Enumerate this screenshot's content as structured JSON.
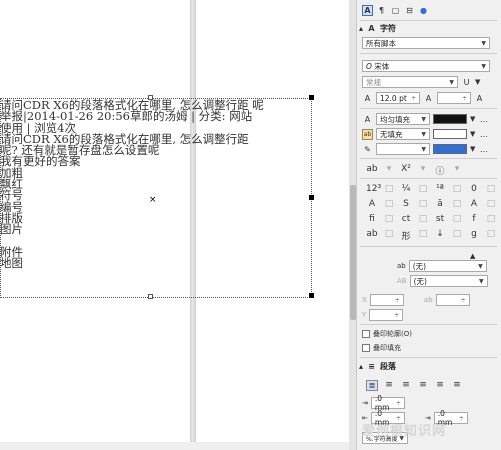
{
  "paragraph_lines": [
    "请问CDR X6的段落格式化在哪里, 怎么调整行距 呢",
    "举报|2014-01-26 20:56草郎的汤姆 | 分类: 网站",
    "使用 | 浏览4次",
    "请问CDR X6的段落格式化在哪里, 怎么调整行距",
    "呢? 还有就是暂存盘怎么设置呢",
    "我有更好的答案",
    "加粗",
    "飘红",
    "符号",
    "编号",
    "排版",
    "图片",
    "",
    "附件",
    "地图"
  ],
  "center_marker": "×",
  "panel": {
    "char_section": "字符",
    "script_select": "所有脚本",
    "font_glyph": "O",
    "font_name": "宋体",
    "style_select": "常规",
    "size_value": "12.0 pt",
    "fill_label": "均匀填充",
    "bg_fill_label": "无填充",
    "bg_prefix": "ab",
    "none_opt_1": "(无)",
    "none_opt_2": "(无)",
    "small_a": "ab",
    "xab_label": "X",
    "ab_label": "AB",
    "outline_check": "叠印轮廓(O)",
    "fill_check": "叠印填充",
    "para_section": "段落",
    "mm_1": ".0 mm",
    "mm_2": ".0 mm",
    "mm_3": ".0 mm",
    "percent_hint": "%.字符高度",
    "watermark": "爱创根知识网"
  },
  "colors": {
    "accent": "#2f6fd6",
    "fill_black": "#111111"
  }
}
